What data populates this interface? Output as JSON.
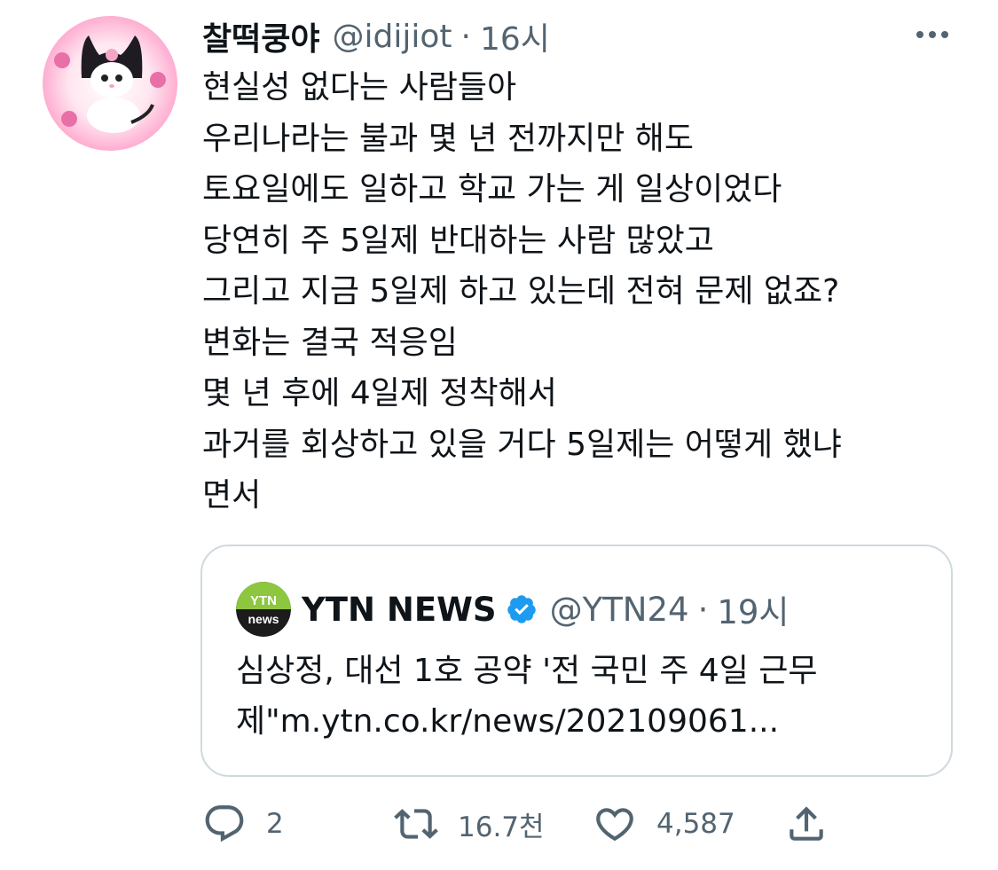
{
  "author": {
    "display_name": "찰떡쿵야",
    "handle": "@idijiot",
    "separator": "·",
    "time": "16시",
    "avatar_icon": "kuromi-figure-avatar"
  },
  "tweet": {
    "lines": [
      "현실성 없다는 사람들아",
      "우리나라는 불과 몇 년 전까지만 해도",
      "토요일에도 일하고 학교 가는 게 일상이었다",
      "당연히 주 5일제 반대하는 사람 많았고",
      "그리고 지금 5일제 하고 있는데 전혀 문제 없죠?",
      "변화는 결국 적응임",
      "몇 년 후에 4일제 정착해서",
      "과거를 회상하고 있을 거다 5일제는 어떻게 했냐",
      "면서"
    ]
  },
  "quote": {
    "logo_text_top": "YTN",
    "logo_text_bottom": "news",
    "name": "YTN NEWS",
    "verified_icon": "verified-badge-icon",
    "handle": "@YTN24",
    "separator": "·",
    "time": "19시",
    "lines": [
      "심상정, 대선 1호 공약 '전 국민 주 4일 근무",
      "제\"m.ytn.co.kr/news/202109061..."
    ]
  },
  "actions": {
    "reply_count": "2",
    "retweet_count": "16.7천",
    "like_count": "4,587"
  },
  "colors": {
    "text_primary": "#0f1419",
    "text_secondary": "#536471",
    "border": "#cfd9de",
    "verified_blue": "#1d9bf0",
    "ytn_green": "#8dc63f"
  }
}
